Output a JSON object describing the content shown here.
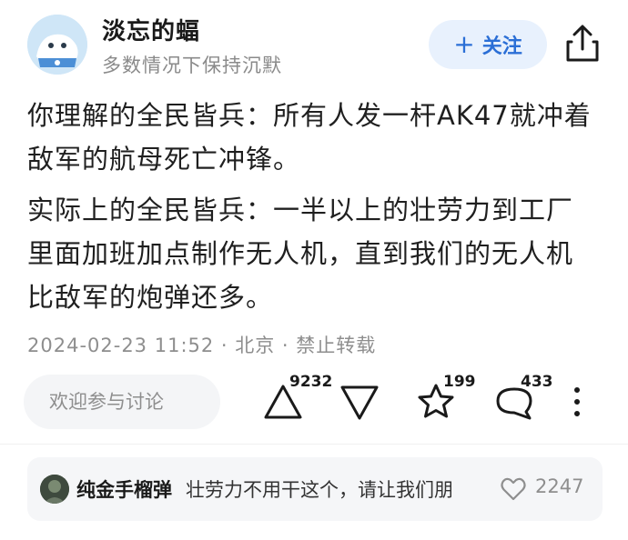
{
  "author": {
    "name": "淡忘的蝠",
    "bio": "多数情况下保持沉默"
  },
  "actions": {
    "follow_label": "关注"
  },
  "post": {
    "paragraph1_line1": "你理解的全民皆兵：所有人发一杆AK47就冲着",
    "paragraph1_line2": "敌军的航母死亡冲锋。",
    "paragraph2_line1": "实际上的全民皆兵：一半以上的壮劳力到工厂",
    "paragraph2_line2": "里面加班加点制作无人机，直到我们的无人机",
    "paragraph2_line3": "比敌军的炮弹还多。",
    "meta": "2024-02-23 11:52 · 北京 · 禁止转载"
  },
  "interaction": {
    "discuss_placeholder": "欢迎参与讨论",
    "upvote_count": "9232",
    "favorite_count": "199",
    "comment_count": "433"
  },
  "top_comment": {
    "user": "纯金手榴弹",
    "text": "壮劳力不用干这个，请让我们朋",
    "likes": "2247"
  },
  "colors": {
    "accent": "#2b6fd6",
    "follow_bg": "#e8f1fd",
    "muted": "#8e8e8e"
  }
}
